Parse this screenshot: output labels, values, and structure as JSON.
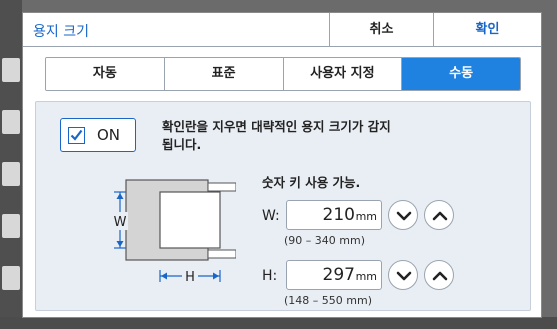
{
  "dialog": {
    "title": "용지 크기",
    "cancel_label": "취소",
    "ok_label": "확인"
  },
  "tabs": [
    {
      "label": "자동",
      "active": false
    },
    {
      "label": "표준",
      "active": false
    },
    {
      "label": "사용자 지정",
      "active": false
    },
    {
      "label": "수동",
      "active": true
    }
  ],
  "on_checkbox": {
    "label": "ON",
    "checked": true
  },
  "hint_text": "확인란을 지우면 대략적인 용지 크기가 감지됩니다.",
  "numeric_keys_text": "숫자 키 사용 가능.",
  "diagram": {
    "w_label": "W",
    "h_label": "H"
  },
  "width_field": {
    "label": "W:",
    "value": "210",
    "unit": "mm",
    "range": "(90 – 340 mm)"
  },
  "height_field": {
    "label": "H:",
    "value": "297",
    "unit": "mm",
    "range": "(148 – 550 mm)"
  },
  "colors": {
    "accent": "#1a66c8",
    "active_tab": "#1f82e0",
    "panel_bg": "#e9eef4"
  }
}
